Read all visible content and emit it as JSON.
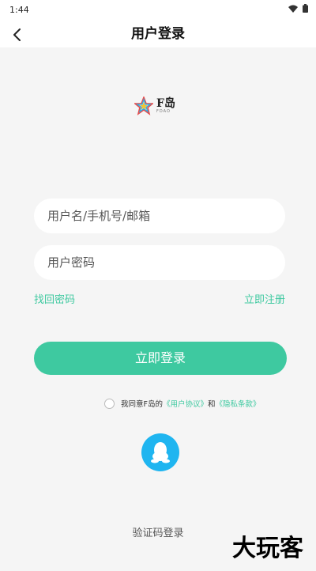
{
  "status_bar": {
    "time": "1:44"
  },
  "header": {
    "title": "用户登录",
    "back_icon": "chevron-left-icon"
  },
  "logo": {
    "text": "F岛",
    "sub": "FDAO"
  },
  "form": {
    "username_placeholder": "用户名/手机号/邮箱",
    "password_placeholder": "用户密码",
    "forgot_password": "找回密码",
    "register": "立即注册",
    "login_button": "立即登录"
  },
  "agreement": {
    "prefix": "我同意F岛的",
    "user_agreement": "《用户协议》",
    "and": "和",
    "privacy_policy": "《隐私条款》"
  },
  "social": {
    "qq_icon": "qq-icon"
  },
  "footer": {
    "sms_login": "验证码登录",
    "watermark": "大玩客"
  },
  "colors": {
    "accent": "#3ec9a0",
    "qq": "#1fb5f0",
    "background": "#f5f5f5"
  }
}
